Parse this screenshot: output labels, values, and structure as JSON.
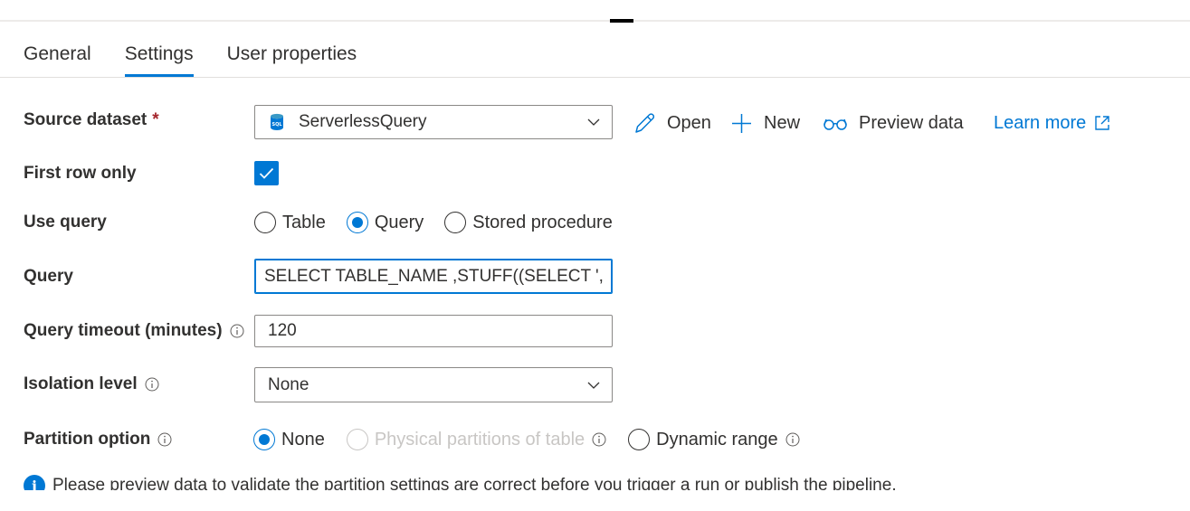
{
  "tabs": [
    {
      "label": "General"
    },
    {
      "label": "Settings"
    },
    {
      "label": "User properties"
    }
  ],
  "active_tab": "Settings",
  "source_dataset": {
    "label": "Source dataset",
    "required_marker": "*",
    "value": "ServerlessQuery",
    "icon": "sql-database-icon"
  },
  "actions": {
    "open": "Open",
    "new": "New",
    "preview": "Preview data",
    "learn_more": "Learn more"
  },
  "first_row_only": {
    "label": "First row only",
    "checked": true
  },
  "use_query": {
    "label": "Use query",
    "options": [
      "Table",
      "Query",
      "Stored procedure"
    ],
    "selected": "Query"
  },
  "query": {
    "label": "Query",
    "value": "SELECT TABLE_NAME ,STUFF((SELECT ',..."
  },
  "query_timeout": {
    "label": "Query timeout (minutes)",
    "value": "120"
  },
  "isolation_level": {
    "label": "Isolation level",
    "value": "None"
  },
  "partition_option": {
    "label": "Partition option",
    "options": [
      "None",
      "Physical partitions of table",
      "Dynamic range"
    ],
    "selected": "None",
    "disabled": [
      "Physical partitions of table"
    ]
  },
  "notice": {
    "text": "Please preview data to validate the partition settings are correct before you trigger a run or publish the pipeline."
  },
  "colors": {
    "accent": "#0078d4",
    "required": "#a4262c",
    "disabled": "#c8c6c4",
    "text": "#323130"
  }
}
